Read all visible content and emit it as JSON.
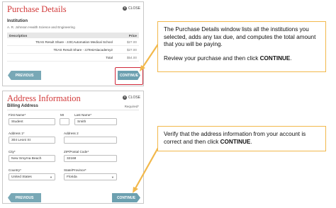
{
  "purchase": {
    "title": "Purchase Details",
    "close_label": "CLOSE",
    "institution_label": "Institution",
    "institution_name": "A. R. Johnson Health Science and Engineering",
    "col_description": "Description",
    "col_price": "Price",
    "rows": [
      {
        "desc": "TEAS Result Share - zztCAutomation Medical School",
        "price": "$27.00"
      },
      {
        "desc": "TEAS Result Share - zzTestAtiacademy2",
        "price": "$27.00"
      }
    ],
    "total_label": "Total",
    "total_value": "$54.00",
    "previous_label": "PREVIOUS",
    "continue_label": "CONTINUE"
  },
  "address": {
    "title": "Address Information",
    "close_label": "CLOSE",
    "billing_label": "Billing Address",
    "required_note": "Required*",
    "first_name_label": "First Name*",
    "first_name_value": "Student",
    "mi_label": "MI",
    "mi_value": "",
    "last_name_label": "Last Name*",
    "last_name_value": "Smith",
    "address1_label": "Address 1*",
    "address1_value": "304 Leoni St",
    "address2_label": "Address 2",
    "address2_value": "",
    "city_label": "City*",
    "city_value": "New Smyrna Beach",
    "zip_label": "ZIP/Postal Code*",
    "zip_value": "32168",
    "country_label": "Country*",
    "country_value": "United States",
    "state_label": "State/Province*",
    "state_value": "Florida",
    "previous_label": "PREVIOUS",
    "continue_label": "CONTINUE"
  },
  "callout1": {
    "para1_pre": "The Purchase Details window lists all the institutions you selected, adds any tax due, and computes the total amount that you will be paying.",
    "para2_pre": "Review your purchase and then click ",
    "para2_bold": "CONTINUE",
    "para2_post": "."
  },
  "callout2": {
    "text_pre": "Verify that the address information from your account is correct and then click ",
    "text_bold": "CONTINUE",
    "text_post": "."
  },
  "colors": {
    "title_red": "#d23a3a",
    "button_teal": "#6ca0b0",
    "callout_border": "#f2b84b",
    "highlight_red": "#d0283a"
  }
}
